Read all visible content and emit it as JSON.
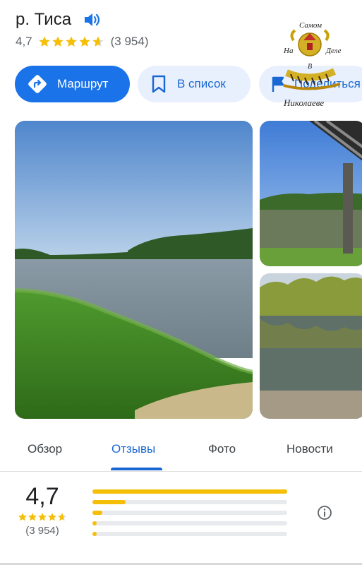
{
  "place": {
    "title": "р. Тиса",
    "rating": "4,7",
    "review_count": "(3 954)"
  },
  "actions": {
    "route": "Маршрут",
    "save": "В список",
    "share": "Поделиться"
  },
  "watermark": {
    "top": "Самом",
    "left": "На",
    "right": "Деле",
    "center": "В",
    "bottom": "Николаеве"
  },
  "tabs": [
    "Обзор",
    "Отзывы",
    "Фото",
    "Новости"
  ],
  "active_tab": "Отзывы",
  "reviews_summary": {
    "rating": "4,7",
    "count": "(3 954)",
    "distribution": [
      {
        "stars": 5,
        "fraction": 1.0
      },
      {
        "stars": 4,
        "fraction": 0.17
      },
      {
        "stars": 3,
        "fraction": 0.05
      },
      {
        "stars": 2,
        "fraction": 0.015
      },
      {
        "stars": 1,
        "fraction": 0.02
      }
    ]
  },
  "colors": {
    "primary": "#1a73e8",
    "tonal_bg": "#e8f0fe",
    "star": "#f5bf08",
    "text_secondary": "#5f6368"
  }
}
